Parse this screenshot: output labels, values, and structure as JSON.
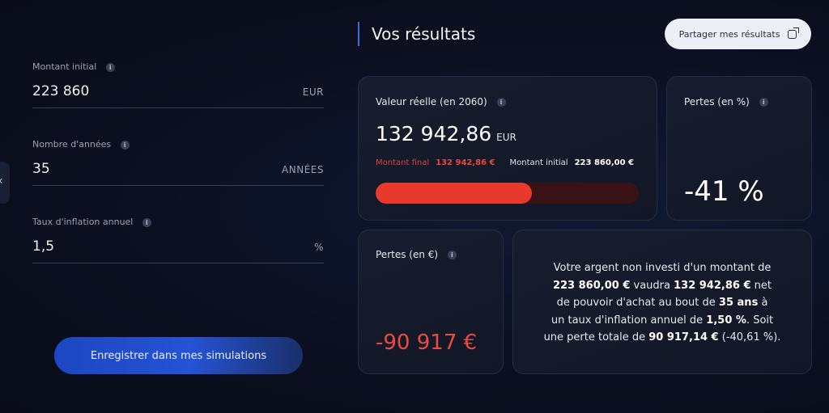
{
  "form": {
    "initial_amount": {
      "label": "Montant initial",
      "value": "223 860",
      "unit": "EUR"
    },
    "years": {
      "label": "Nombre d'années",
      "value": "35",
      "unit": "ANNÉES"
    },
    "inflation": {
      "label": "Taux d'inflation annuel",
      "value": "1,5",
      "unit": "%"
    },
    "save_label": "Enregistrer dans mes simulations"
  },
  "header": {
    "title": "Vos résultats",
    "share_label": "Partager mes résultats"
  },
  "real_value_card": {
    "title": "Valeur réelle (en 2060)",
    "value": "132 942,86",
    "currency": "EUR",
    "final_label": "Montant final",
    "final_value": "132 942,86 €",
    "initial_label": "Montant initial",
    "initial_value": "223 860,00 €",
    "progress_fraction": 0.594
  },
  "loss_pct_card": {
    "title": "Pertes (en %)",
    "value": "-41 %"
  },
  "loss_eur_card": {
    "title": "Pertes (en €)",
    "value": "-90 917 €"
  },
  "summary": {
    "t1": "Votre argent non investi d'un montant de",
    "b1": "223 860,00 €",
    "t2": "vaudra",
    "b2": "132 942,86 €",
    "t3": "net",
    "t4": "de pouvoir d'achat au bout de",
    "b3": "35 ans",
    "t5": "à",
    "t6": "un taux d'inflation annuel de",
    "b4": "1,50 %",
    "t7": ". Soit",
    "t8": "une perte totale de",
    "b5": "90 917,14 €",
    "t9": "(-40,61 %)."
  },
  "colors": {
    "accent": "#2553d4",
    "loss": "#e8392d"
  }
}
